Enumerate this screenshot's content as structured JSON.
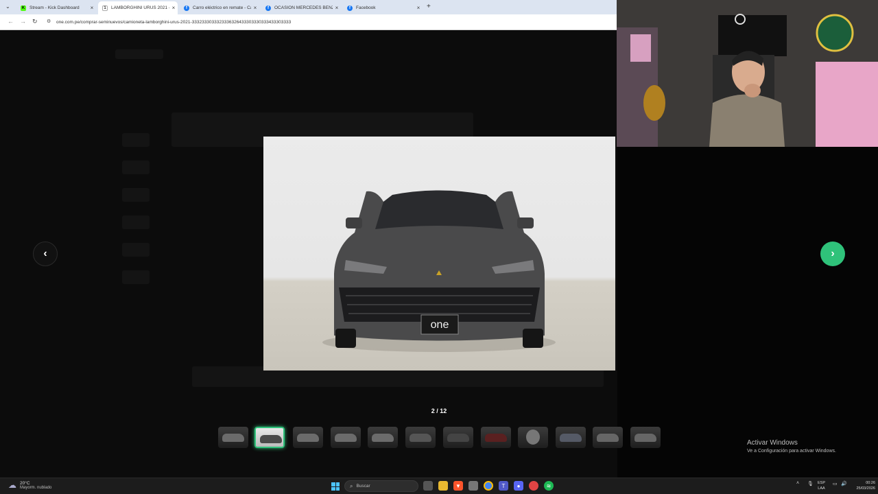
{
  "browser": {
    "tabs": [
      {
        "title": "Stream - Kick Dashboard",
        "favicon": "kick-icon",
        "active": false
      },
      {
        "title": "LAMBORGHINI URUS 2021 - O",
        "favicon": "one-icon",
        "active": true
      },
      {
        "title": "Carro eléctrico en remate - Car",
        "favicon": "facebook-icon",
        "active": false
      },
      {
        "title": "OCASIÓN MERCEDES BENZ GL",
        "favicon": "facebook-icon",
        "active": false
      },
      {
        "title": "Facebook",
        "favicon": "facebook-icon",
        "active": false
      }
    ],
    "new_tab": "+",
    "url": "one.com.pe/comprar-seminuevos/camioneta-lamborghini-urus-2021-3332333033323336326433303330333433303333"
  },
  "gallery": {
    "counter": "2 / 12",
    "current_index": 2,
    "total": 12,
    "plate_text": "one",
    "accent_color": "#2fc27a",
    "thumbnails": [
      {
        "label": "thumbnail-1"
      },
      {
        "label": "thumbnail-2"
      },
      {
        "label": "thumbnail-3"
      },
      {
        "label": "thumbnail-4"
      },
      {
        "label": "thumbnail-5"
      },
      {
        "label": "thumbnail-6"
      },
      {
        "label": "thumbnail-7"
      },
      {
        "label": "thumbnail-8"
      },
      {
        "label": "thumbnail-9"
      },
      {
        "label": "thumbnail-10"
      },
      {
        "label": "thumbnail-11"
      },
      {
        "label": "thumbnail-12"
      }
    ]
  },
  "watermark": {
    "title": "Activar Windows",
    "subtitle": "Ve a Configuración para activar Windows."
  },
  "taskbar": {
    "weather_temp": "20°C",
    "weather_desc": "Mayorm. nublado",
    "search_placeholder": "Buscar",
    "lang_1": "ESP",
    "lang_2": "LAA",
    "time": "00:26",
    "date": "25/03/2026"
  }
}
